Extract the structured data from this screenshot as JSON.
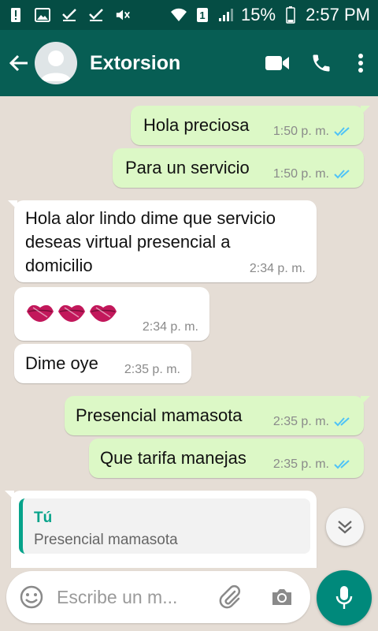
{
  "status_bar": {
    "battery_percent": "15%",
    "sim_badge": "1",
    "time": "2:57 PM",
    "icons": [
      "alert-icon",
      "image-icon",
      "check-icon",
      "check-icon",
      "mute-icon",
      "wifi-icon",
      "sim-icon",
      "signal-icon",
      "battery-icon"
    ]
  },
  "header": {
    "contact_name": "Extorsion",
    "icons": [
      "back-arrow-icon",
      "avatar",
      "video-call-icon",
      "phone-icon",
      "more-vert-icon"
    ]
  },
  "messages": [
    {
      "direction": "out",
      "text": "Hola preciosa",
      "time": "1:50 p. m.",
      "read": true
    },
    {
      "direction": "out",
      "text": "Para un servicio",
      "time": "1:50 p. m.",
      "read": true
    },
    {
      "direction": "in",
      "lines": [
        "Hola alor lindo dime que servicio",
        "deseas virtual presencial a",
        "domicilio"
      ],
      "time": "2:34 p. m."
    },
    {
      "direction": "in",
      "emoji": "kiss-mark-emoji x3",
      "time": "2:34 p. m."
    },
    {
      "direction": "in",
      "text": "Dime oye",
      "time": "2:35 p. m."
    },
    {
      "direction": "out",
      "text": "Presencial mamasota",
      "time": "2:35 p. m.",
      "read": true
    },
    {
      "direction": "out",
      "text": "Que tarifa manejas",
      "time": "2:35 p. m.",
      "read": true
    },
    {
      "direction": "in",
      "quote_author": "Tú",
      "quote_text": "Presencial mamasota"
    }
  ],
  "input": {
    "placeholder": "Escribe un m..."
  },
  "colors": {
    "status_bar": "#054d44",
    "app_bar": "#075e54",
    "chat_bg": "#e5ddd5",
    "outgoing_bubble": "#dcf8c6",
    "incoming_bubble": "#ffffff",
    "read_ticks": "#4fc3f7",
    "accent": "#00897b",
    "quote_accent": "#06a38a"
  }
}
